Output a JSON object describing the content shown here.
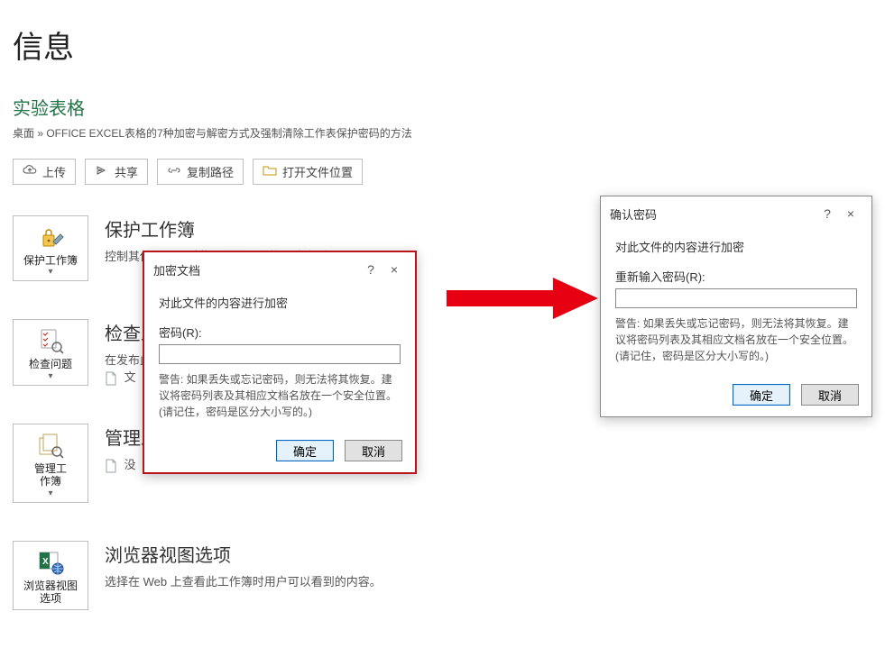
{
  "header": {
    "page_title": "信息",
    "doc_name": "实验表格",
    "breadcrumb": "桌面 » OFFICE EXCEL表格的7种加密与解密方式及强制清除工作表保护密码的方法"
  },
  "toolbar": {
    "upload": "上传",
    "share": "共享",
    "copy_path": "复制路径",
    "open_location": "打开文件位置"
  },
  "sections": {
    "protect": {
      "tile": "保护工作簿",
      "title": "保护工作簿",
      "desc": "控制其他人可以对此工作簿所做的更改类型。"
    },
    "inspect": {
      "tile": "检查问题",
      "title": "检查工作簿",
      "desc1": "在发布此文件之前，",
      "desc2_icon_label": "文"
    },
    "manage": {
      "tile": "管理工\n作簿",
      "title": "管理工作簿",
      "desc_icon_prefix": "没"
    },
    "browser": {
      "tile": "浏览器视图\n选项",
      "title": "浏览器视图选项",
      "desc": "选择在 Web 上查看此工作簿时用户可以看到的内容。"
    }
  },
  "dialog_encrypt": {
    "title": "加密文档",
    "sub": "对此文件的内容进行加密",
    "pwd_label": "密码(R):",
    "warn": "警告: 如果丢失或忘记密码，则无法将其恢复。建议将密码列表及其相应文档名放在一个安全位置。\n(请记住，密码是区分大小写的。)",
    "ok": "确定",
    "cancel": "取消",
    "help": "?",
    "close": "×"
  },
  "dialog_confirm": {
    "title": "确认密码",
    "sub": "对此文件的内容进行加密",
    "pwd_label": "重新输入密码(R):",
    "warn": "警告: 如果丢失或忘记密码，则无法将其恢复。建议将密码列表及其相应文档名放在一个安全位置。\n(请记住，密码是区分大小写的。)",
    "ok": "确定",
    "cancel": "取消",
    "help": "?",
    "close": "×"
  },
  "colors": {
    "accent_green": "#217346",
    "alert_red": "#ba141a",
    "primary_blue": "#0067c0"
  }
}
